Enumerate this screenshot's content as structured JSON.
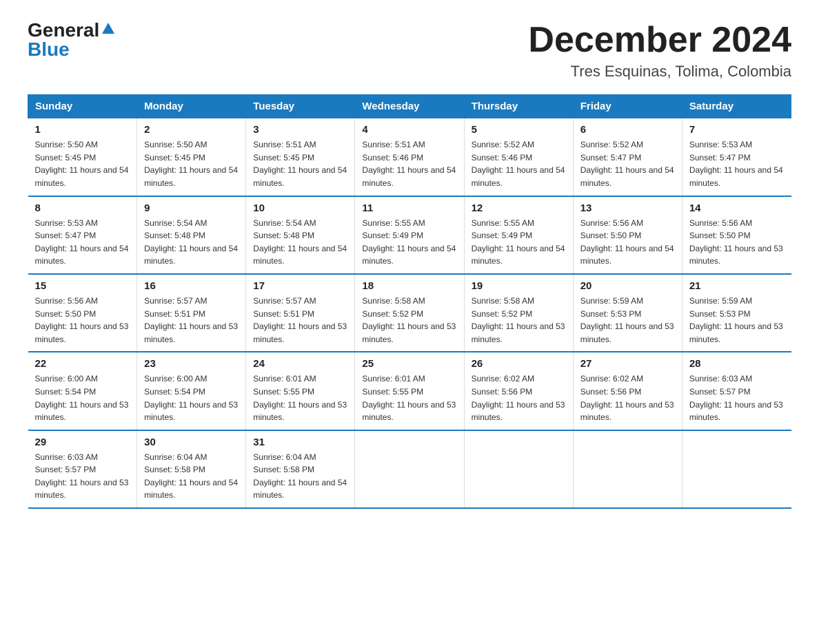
{
  "logo": {
    "general": "General",
    "blue": "Blue"
  },
  "title": {
    "month": "December 2024",
    "location": "Tres Esquinas, Tolima, Colombia"
  },
  "headers": [
    "Sunday",
    "Monday",
    "Tuesday",
    "Wednesday",
    "Thursday",
    "Friday",
    "Saturday"
  ],
  "weeks": [
    [
      {
        "day": "1",
        "sunrise": "5:50 AM",
        "sunset": "5:45 PM",
        "daylight": "11 hours and 54 minutes."
      },
      {
        "day": "2",
        "sunrise": "5:50 AM",
        "sunset": "5:45 PM",
        "daylight": "11 hours and 54 minutes."
      },
      {
        "day": "3",
        "sunrise": "5:51 AM",
        "sunset": "5:45 PM",
        "daylight": "11 hours and 54 minutes."
      },
      {
        "day": "4",
        "sunrise": "5:51 AM",
        "sunset": "5:46 PM",
        "daylight": "11 hours and 54 minutes."
      },
      {
        "day": "5",
        "sunrise": "5:52 AM",
        "sunset": "5:46 PM",
        "daylight": "11 hours and 54 minutes."
      },
      {
        "day": "6",
        "sunrise": "5:52 AM",
        "sunset": "5:47 PM",
        "daylight": "11 hours and 54 minutes."
      },
      {
        "day": "7",
        "sunrise": "5:53 AM",
        "sunset": "5:47 PM",
        "daylight": "11 hours and 54 minutes."
      }
    ],
    [
      {
        "day": "8",
        "sunrise": "5:53 AM",
        "sunset": "5:47 PM",
        "daylight": "11 hours and 54 minutes."
      },
      {
        "day": "9",
        "sunrise": "5:54 AM",
        "sunset": "5:48 PM",
        "daylight": "11 hours and 54 minutes."
      },
      {
        "day": "10",
        "sunrise": "5:54 AM",
        "sunset": "5:48 PM",
        "daylight": "11 hours and 54 minutes."
      },
      {
        "day": "11",
        "sunrise": "5:55 AM",
        "sunset": "5:49 PM",
        "daylight": "11 hours and 54 minutes."
      },
      {
        "day": "12",
        "sunrise": "5:55 AM",
        "sunset": "5:49 PM",
        "daylight": "11 hours and 54 minutes."
      },
      {
        "day": "13",
        "sunrise": "5:56 AM",
        "sunset": "5:50 PM",
        "daylight": "11 hours and 54 minutes."
      },
      {
        "day": "14",
        "sunrise": "5:56 AM",
        "sunset": "5:50 PM",
        "daylight": "11 hours and 53 minutes."
      }
    ],
    [
      {
        "day": "15",
        "sunrise": "5:56 AM",
        "sunset": "5:50 PM",
        "daylight": "11 hours and 53 minutes."
      },
      {
        "day": "16",
        "sunrise": "5:57 AM",
        "sunset": "5:51 PM",
        "daylight": "11 hours and 53 minutes."
      },
      {
        "day": "17",
        "sunrise": "5:57 AM",
        "sunset": "5:51 PM",
        "daylight": "11 hours and 53 minutes."
      },
      {
        "day": "18",
        "sunrise": "5:58 AM",
        "sunset": "5:52 PM",
        "daylight": "11 hours and 53 minutes."
      },
      {
        "day": "19",
        "sunrise": "5:58 AM",
        "sunset": "5:52 PM",
        "daylight": "11 hours and 53 minutes."
      },
      {
        "day": "20",
        "sunrise": "5:59 AM",
        "sunset": "5:53 PM",
        "daylight": "11 hours and 53 minutes."
      },
      {
        "day": "21",
        "sunrise": "5:59 AM",
        "sunset": "5:53 PM",
        "daylight": "11 hours and 53 minutes."
      }
    ],
    [
      {
        "day": "22",
        "sunrise": "6:00 AM",
        "sunset": "5:54 PM",
        "daylight": "11 hours and 53 minutes."
      },
      {
        "day": "23",
        "sunrise": "6:00 AM",
        "sunset": "5:54 PM",
        "daylight": "11 hours and 53 minutes."
      },
      {
        "day": "24",
        "sunrise": "6:01 AM",
        "sunset": "5:55 PM",
        "daylight": "11 hours and 53 minutes."
      },
      {
        "day": "25",
        "sunrise": "6:01 AM",
        "sunset": "5:55 PM",
        "daylight": "11 hours and 53 minutes."
      },
      {
        "day": "26",
        "sunrise": "6:02 AM",
        "sunset": "5:56 PM",
        "daylight": "11 hours and 53 minutes."
      },
      {
        "day": "27",
        "sunrise": "6:02 AM",
        "sunset": "5:56 PM",
        "daylight": "11 hours and 53 minutes."
      },
      {
        "day": "28",
        "sunrise": "6:03 AM",
        "sunset": "5:57 PM",
        "daylight": "11 hours and 53 minutes."
      }
    ],
    [
      {
        "day": "29",
        "sunrise": "6:03 AM",
        "sunset": "5:57 PM",
        "daylight": "11 hours and 53 minutes."
      },
      {
        "day": "30",
        "sunrise": "6:04 AM",
        "sunset": "5:58 PM",
        "daylight": "11 hours and 54 minutes."
      },
      {
        "day": "31",
        "sunrise": "6:04 AM",
        "sunset": "5:58 PM",
        "daylight": "11 hours and 54 minutes."
      },
      null,
      null,
      null,
      null
    ]
  ]
}
